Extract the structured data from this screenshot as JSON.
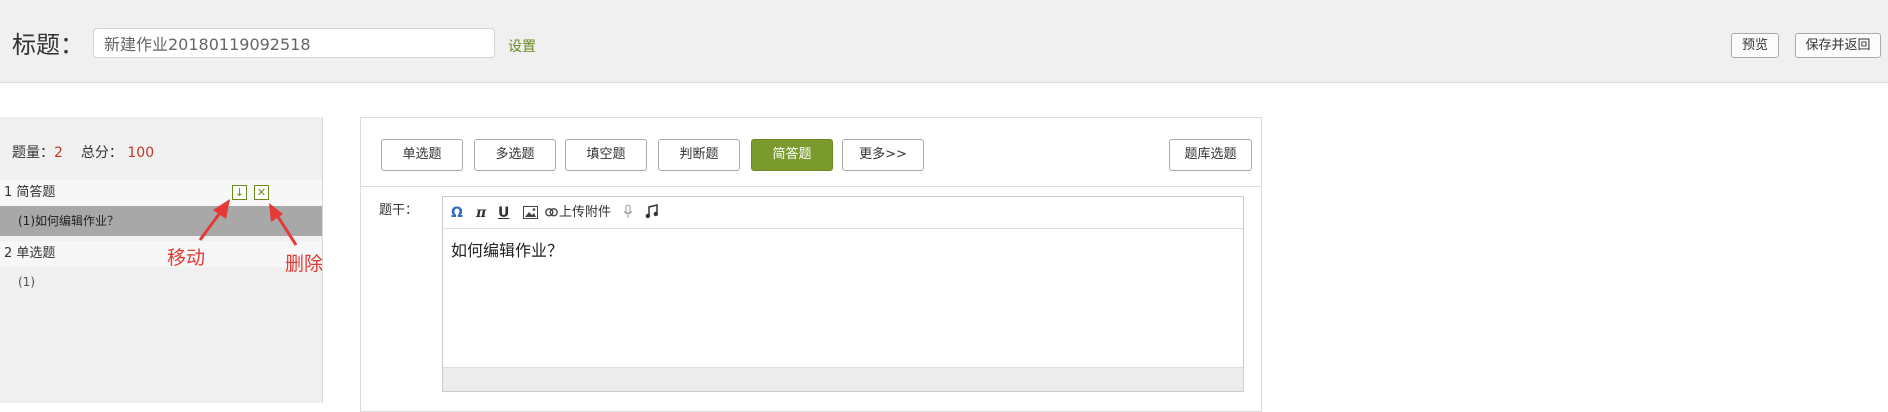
{
  "header": {
    "title_label": "标题：",
    "title_value": "新建作业20180119092518",
    "settings_link": "设置",
    "preview_button": "预览",
    "save_return_button": "保存并返回"
  },
  "sidebar": {
    "count_label": "题量：",
    "count_value": "2",
    "score_label": "总分：",
    "score_value": "100",
    "sections": [
      {
        "label": "1 简答题",
        "items": [
          {
            "label": "(1)如何编辑作业？"
          }
        ]
      },
      {
        "label": "2 单选题",
        "items": [
          {
            "label": "(1)"
          }
        ]
      }
    ],
    "move_icon_glyph": "↓",
    "delete_icon_glyph": "✕"
  },
  "annotations": {
    "move": "移动",
    "delete": "删除",
    "color": "#e53935"
  },
  "question_types": {
    "buttons": [
      {
        "label": "单选题"
      },
      {
        "label": "多选题"
      },
      {
        "label": "填空题"
      },
      {
        "label": "判断题"
      },
      {
        "label": "简答题"
      },
      {
        "label": "更多>>"
      }
    ],
    "active": "简答题",
    "bank_button": "题库选题",
    "accent_color": "#7a9a2e"
  },
  "editor": {
    "stem_label": "题干：",
    "toolbar": {
      "omega": "Ω",
      "pi": "π",
      "underline": "U",
      "attach_label": "上传附件",
      "icons": [
        "omega-icon",
        "pi-icon",
        "underline-icon",
        "image-icon",
        "link-icon",
        "mic-icon",
        "music-icon"
      ]
    },
    "content": "如何编辑作业？"
  }
}
